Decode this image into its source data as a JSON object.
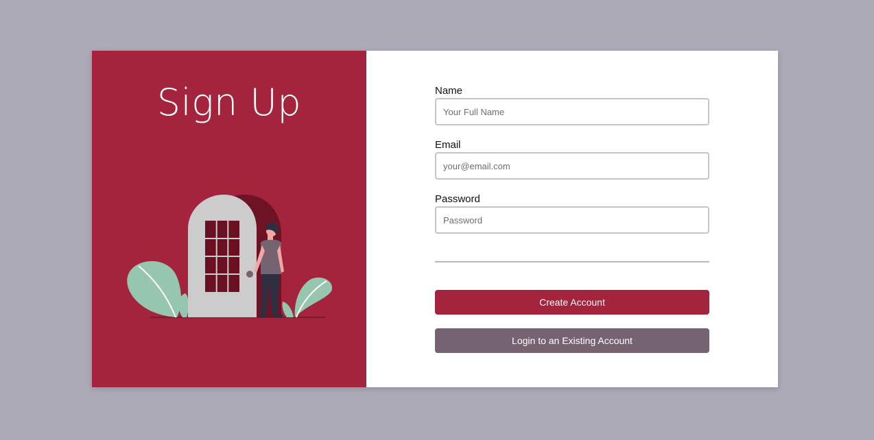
{
  "left_panel": {
    "title": "Sign Up",
    "background_color": "#a4233d",
    "illustration": "person-at-door-illustration"
  },
  "form": {
    "fields": [
      {
        "label": "Name",
        "placeholder": "Your Full Name",
        "value": ""
      },
      {
        "label": "Email",
        "placeholder": "your@email.com",
        "value": ""
      },
      {
        "label": "Password",
        "placeholder": "Password",
        "value": ""
      }
    ],
    "primary_button": "Create Account",
    "secondary_button": "Login to an Existing Account"
  },
  "colors": {
    "page_background": "#adaab8",
    "accent": "#a4233d",
    "secondary_button": "#766372",
    "plant": "#97c6b0"
  }
}
